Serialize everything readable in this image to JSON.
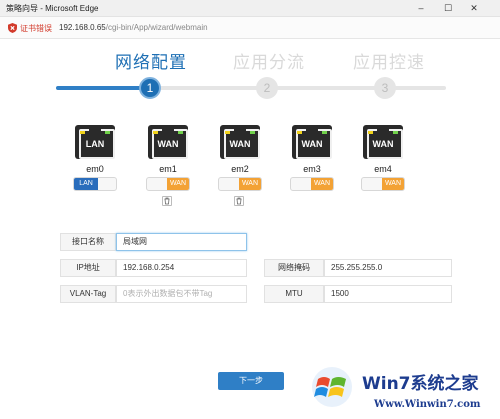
{
  "window": {
    "title": "策略向导 - Microsoft Edge",
    "min": "–",
    "max": "☐",
    "close": "✕"
  },
  "address": {
    "cert_warning": "证书错误",
    "url_host": "192.168.0.65",
    "url_path": "/cgi-bin/App/wizard/webmain"
  },
  "steps": [
    {
      "label": "网络配置",
      "number": "1",
      "state": "active"
    },
    {
      "label": "应用分流",
      "number": "2",
      "state": "inactive"
    },
    {
      "label": "应用控速",
      "number": "3",
      "state": "inactive"
    }
  ],
  "ports": [
    {
      "name": "em0",
      "type": "LAN",
      "toggle_label": "LAN"
    },
    {
      "name": "em1",
      "type": "WAN",
      "toggle_label": "WAN"
    },
    {
      "name": "em2",
      "type": "WAN",
      "toggle_label": "WAN"
    },
    {
      "name": "em3",
      "type": "WAN",
      "toggle_label": "WAN"
    },
    {
      "name": "em4",
      "type": "WAN",
      "toggle_label": "WAN"
    }
  ],
  "form": {
    "interface_name": {
      "label": "接口名称",
      "value": "局域网"
    },
    "ip": {
      "label": "IP地址",
      "value": "192.168.0.254"
    },
    "mask": {
      "label": "网络掩码",
      "value": "255.255.255.0"
    },
    "vlan": {
      "label": "VLAN-Tag",
      "placeholder": "0表示外出数据包不带Tag"
    },
    "mtu": {
      "label": "MTU",
      "value": "1500"
    }
  },
  "buttons": {
    "next": "下一步"
  },
  "watermark": {
    "text": "Win7系统之家",
    "url": "Www.Winwin7.com"
  },
  "colors": {
    "accent": "#1e6fb4",
    "lan": "#2a6dbc",
    "wan": "#f3a235",
    "error": "#d23a2b"
  }
}
